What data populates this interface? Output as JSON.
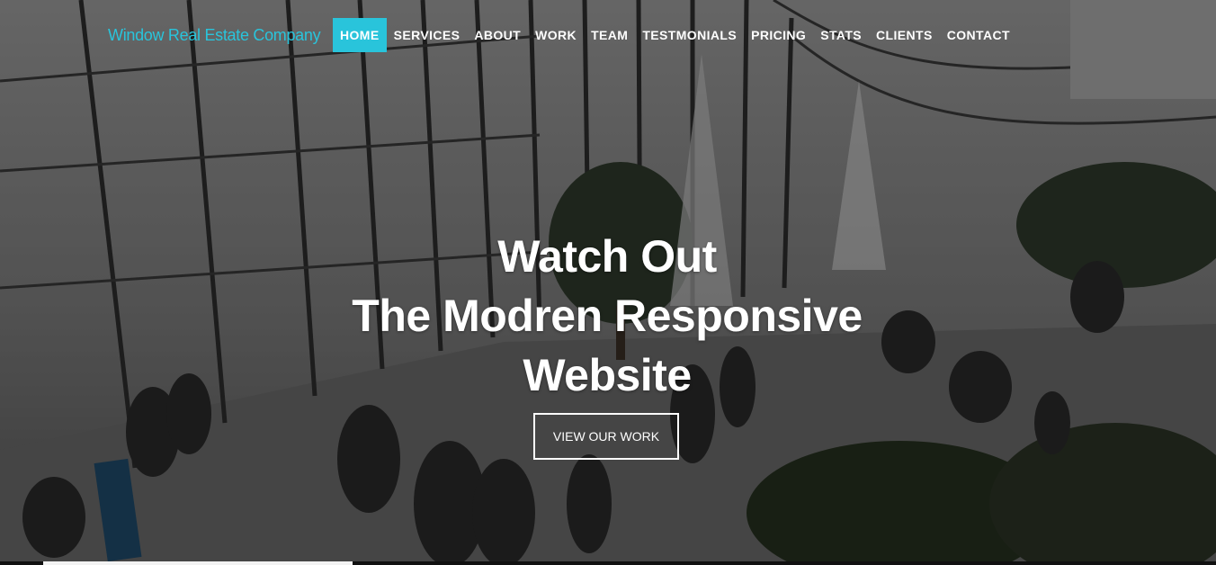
{
  "brand": {
    "name": "Window Real Estate Company"
  },
  "nav": {
    "items": [
      {
        "label": "HOME",
        "active": true
      },
      {
        "label": "SERVICES"
      },
      {
        "label": "ABOUT"
      },
      {
        "label": "WORK"
      },
      {
        "label": "TEAM"
      },
      {
        "label": "TESTMONIALS"
      },
      {
        "label": "PRICING"
      },
      {
        "label": "STATS"
      },
      {
        "label": "CLIENTS"
      },
      {
        "label": "CONTACT"
      }
    ]
  },
  "hero": {
    "line1": "Watch Out",
    "line2": "The Modren Responsive",
    "line3": "Website",
    "cta_label": "VIEW OUR WORK",
    "background_description_icon": "glass-atrium-photo"
  },
  "colors": {
    "accent": "#29c4db",
    "text": "#ffffff"
  }
}
